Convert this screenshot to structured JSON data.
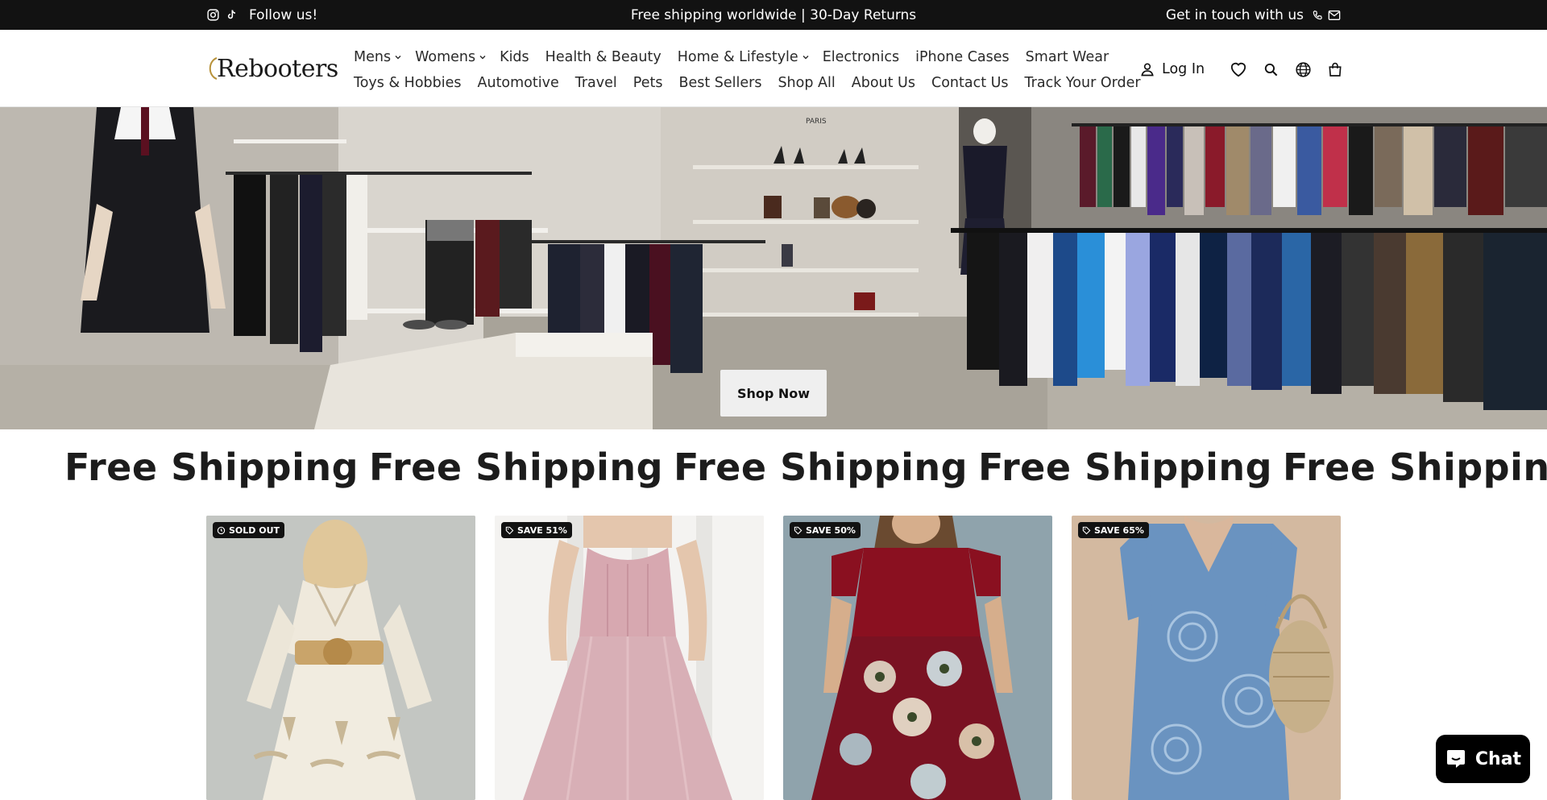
{
  "announcement": {
    "follow_text": "Follow us!",
    "center_text": "Free shipping worldwide | 30-Day Returns",
    "contact_text": "Get in touch with us",
    "icons": [
      "instagram-icon",
      "tiktok-icon",
      "phone-icon",
      "mail-icon"
    ]
  },
  "header": {
    "logo_text": "Rebooters",
    "nav_row1": [
      {
        "label": "Mens",
        "dropdown": true
      },
      {
        "label": "Womens",
        "dropdown": true
      },
      {
        "label": "Kids",
        "dropdown": false
      },
      {
        "label": "Health & Beauty",
        "dropdown": false
      },
      {
        "label": "Home & Lifestyle",
        "dropdown": true
      },
      {
        "label": "Electronics",
        "dropdown": false
      },
      {
        "label": "iPhone Cases",
        "dropdown": false
      },
      {
        "label": "Smart Wear",
        "dropdown": false
      }
    ],
    "nav_row2": [
      {
        "label": "Toys & Hobbies"
      },
      {
        "label": "Automotive"
      },
      {
        "label": "Travel"
      },
      {
        "label": "Pets"
      },
      {
        "label": "Best Sellers"
      },
      {
        "label": "Shop All"
      },
      {
        "label": "About Us"
      },
      {
        "label": "Contact Us"
      },
      {
        "label": "Track Your Order"
      }
    ],
    "login_label": "Log In",
    "icons": [
      "user-icon",
      "heart-icon",
      "search-icon",
      "globe-icon",
      "bag-icon"
    ]
  },
  "hero": {
    "button_label": "Shop Now",
    "store_sign": "PARIS"
  },
  "marquee": {
    "text": "Free Shipping",
    "repeat": 5
  },
  "products": [
    {
      "badge": "SOLD OUT",
      "badge_icon": "clock-icon",
      "image": "white-boho-dress"
    },
    {
      "badge": "SAVE 51%",
      "badge_icon": "tag-icon",
      "image": "pink-tulle-dress"
    },
    {
      "badge": "SAVE 50%",
      "badge_icon": "tag-icon",
      "image": "red-floral-dress"
    },
    {
      "badge": "SAVE 65%",
      "badge_icon": "tag-icon",
      "image": "blue-print-dress"
    }
  ],
  "chat": {
    "label": "Chat",
    "icon": "chat-bubble-icon"
  },
  "colors": {
    "announcement_bg": "#121212",
    "button_bg": "#efefef",
    "badge_bg": "#121212",
    "chat_bg": "#000000"
  }
}
